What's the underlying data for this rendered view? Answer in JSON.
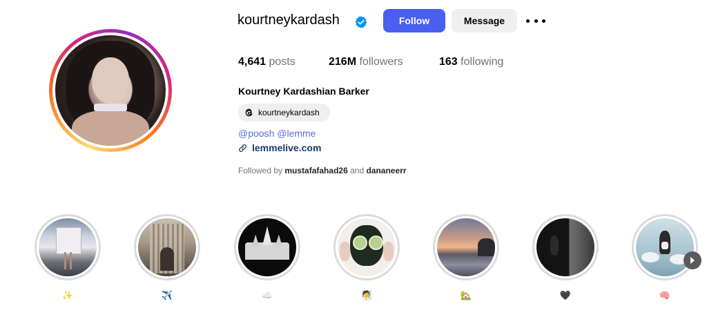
{
  "profile": {
    "username": "kourtneykardash",
    "verified_icon": "verified-badge-icon",
    "follow_label": "Follow",
    "message_label": "Message",
    "more_icon": "more-options-icon",
    "stats": {
      "posts_value": "4,641",
      "posts_label": "posts",
      "followers_value": "216M",
      "followers_label": "followers",
      "following_value": "163",
      "following_label": "following"
    },
    "full_name": "Kourtney Kardashian Barker",
    "threads_handle": "kourtneykardash",
    "mention_1": "@poosh",
    "mention_2": "@lemme",
    "website": "lemmelive.com",
    "followed_by_prefix": "Followed by",
    "followed_by_user_1": "mustafafahad26",
    "followed_by_and": "and",
    "followed_by_user_2": "dananeerr"
  },
  "highlights": [
    {
      "label": "✨",
      "theme": "street-poster"
    },
    {
      "label": "✈️",
      "theme": "cathedral"
    },
    {
      "label": "☁️",
      "theme": "castle"
    },
    {
      "label": "🧖",
      "theme": "face-mask"
    },
    {
      "label": "🏡",
      "theme": "sunset-pool"
    },
    {
      "label": "🖤",
      "theme": "dark-silhouette"
    },
    {
      "label": "🧠",
      "theme": "cartoon"
    }
  ],
  "colors": {
    "follow_button": "#4a5ff0",
    "verified": "#0095f6",
    "link": "#1b3a6b",
    "mentions": "#5b6fd0"
  }
}
